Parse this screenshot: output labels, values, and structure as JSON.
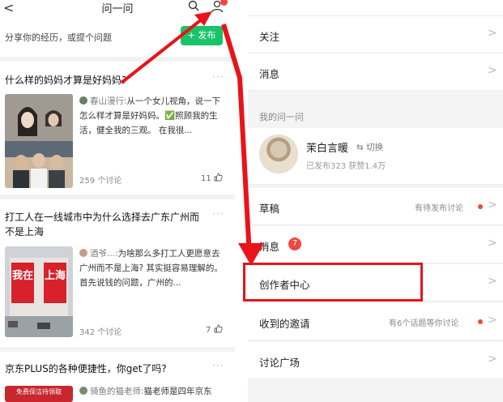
{
  "left": {
    "back_glyph": "<",
    "title": "问一问",
    "share_prompt": "分享你的经历，或提个问题",
    "publish_label": "+ 发布",
    "questions": [
      {
        "title": "什么样的妈妈才算是好妈妈?",
        "author": "春山漫行:",
        "excerpt": "从一个女儿视角，说一下怎么样才算是好妈妈。✅照顾我的生活，健全我的三观。 在我很...",
        "discussions": "259 个讨论",
        "likes": "11"
      },
      {
        "title": "打工人在一线城市中为什么选择去广东广州而不是上海",
        "author": "酒爷...:",
        "excerpt": "为啥那么多打工人更愿意去广州而不是上海? 其实挺容易理解的。 首先说钱的问题，广州的...",
        "discussions": "342 个讨论",
        "likes": "7",
        "img_text_left": "我在",
        "img_text_right": "上海"
      },
      {
        "title": "京东PLUS的各种便捷性，你get了吗?",
        "author": "骑鱼的猫老师:",
        "excerpt": "猫老师是四年京东",
        "img_banner": "免费保洁待领取"
      }
    ],
    "more": "···"
  },
  "right": {
    "rows_top": [
      {
        "label": "关注"
      },
      {
        "label": "消息"
      }
    ],
    "section_header": "我的问一问",
    "profile": {
      "name": "茉白言暖",
      "switch": "⇆ 切换",
      "stats": "已发布323   获赞1.4万"
    },
    "rows": [
      {
        "label": "草稿",
        "note": "有待发布讨论"
      },
      {
        "label": "消息",
        "badge": "7"
      },
      {
        "label": "创作者中心"
      },
      {
        "label": "收到的邀请",
        "note": "有6个话题等你讨论"
      },
      {
        "label": "讨论广场"
      }
    ],
    "chevron": ">"
  },
  "colors": {
    "accent_green": "#19c36a",
    "annotation_red": "#e8141b",
    "badge_red": "#f0483e"
  }
}
